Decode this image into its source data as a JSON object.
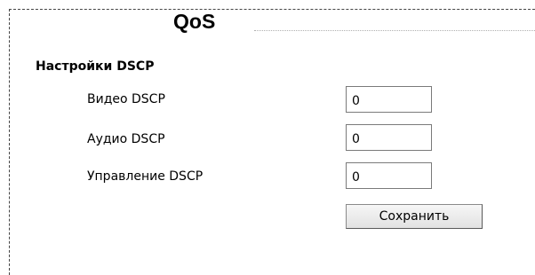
{
  "page": {
    "title": "QoS"
  },
  "dscp_settings": {
    "heading": "Настройки DSCP",
    "fields": [
      {
        "label": "Видео DSCP",
        "value": "0"
      },
      {
        "label": "Аудио DSCP",
        "value": "0"
      },
      {
        "label": "Управление DSCP",
        "value": "0"
      }
    ],
    "save_label": "Сохранить"
  },
  "colors": {
    "background": "#ffffff",
    "text": "#000000",
    "input_border": "#7a7a7a",
    "panel_border": "#444444"
  }
}
